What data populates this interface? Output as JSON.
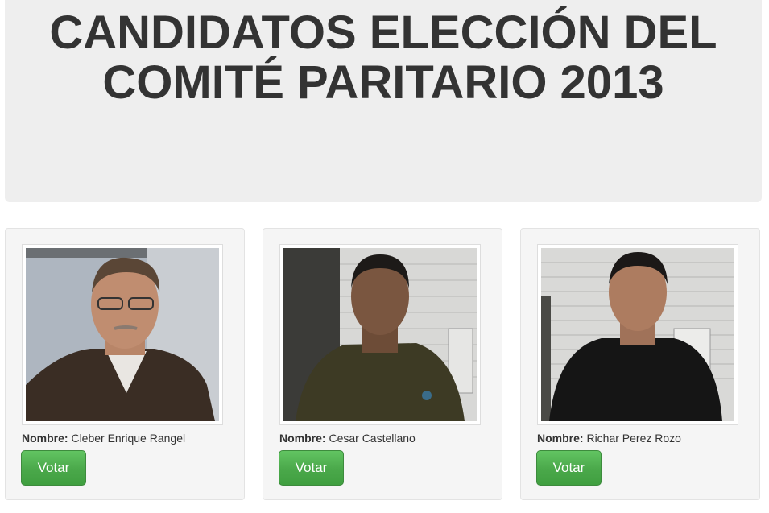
{
  "header": {
    "title": "CANDIDATOS ELECCIÓN DEL COMITÉ PARITARIO 2013"
  },
  "candidates": [
    {
      "name_label": "Nombre:",
      "name": "Cleber Enrique Rangel",
      "vote_label": "Votar"
    },
    {
      "name_label": "Nombre:",
      "name": "Cesar Castellano",
      "vote_label": "Votar"
    },
    {
      "name_label": "Nombre:",
      "name": "Richar Perez Rozo",
      "vote_label": "Votar"
    }
  ],
  "colors": {
    "hero_background": "#eeeeee",
    "card_background": "#f5f5f5",
    "vote_button": "#5cb85c"
  }
}
